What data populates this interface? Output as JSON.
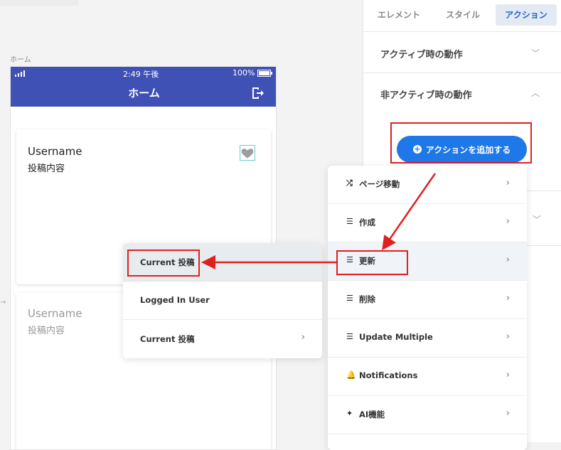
{
  "canvas": {
    "page_label": "ホーム"
  },
  "phone": {
    "status": {
      "time": "2:49 午後",
      "battery": "100%"
    },
    "appbar_title": "ホーム",
    "cards": [
      {
        "username": "Username",
        "content": "投稿内容"
      },
      {
        "username": "Username",
        "content": "投稿内容"
      }
    ]
  },
  "panel": {
    "tabs": [
      {
        "label": "エレメント",
        "active": false
      },
      {
        "label": "スタイル",
        "active": false
      },
      {
        "label": "アクション",
        "active": true
      }
    ],
    "sections": {
      "active": "アクティブ時の動作",
      "inactive": "非アクティブ時の動作"
    },
    "add_action_label": "アクションを追加する"
  },
  "action_menu": [
    {
      "label": "ページ移動",
      "icon": "shuffle-icon"
    },
    {
      "label": "作成",
      "icon": "database-icon"
    },
    {
      "label": "更新",
      "icon": "database-icon"
    },
    {
      "label": "削除",
      "icon": "database-icon"
    },
    {
      "label": "Update Multiple",
      "icon": "database-icon"
    },
    {
      "label": "Notifications",
      "icon": "bell-icon"
    },
    {
      "label": "AI機能",
      "icon": "magic-wand-icon"
    }
  ],
  "submenu": [
    {
      "label": "Current 投稿"
    },
    {
      "label": "Logged In User"
    },
    {
      "label": "Current 投稿"
    }
  ],
  "colors": {
    "appbar": "#3f51b5",
    "accent": "#1e78e8",
    "highlight": "#e02020"
  }
}
